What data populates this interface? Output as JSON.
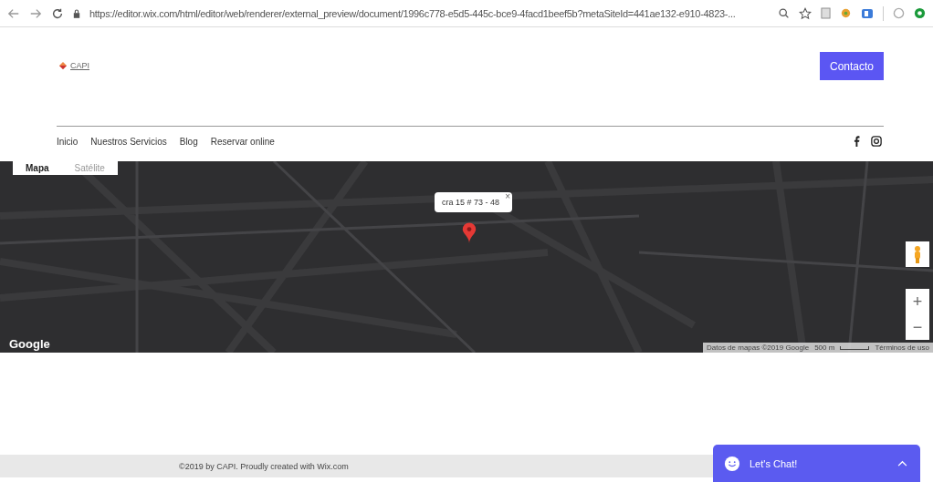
{
  "browser": {
    "url": "https://editor.wix.com/html/editor/web/renderer/external_preview/document/1996c778-e5d5-445c-bce9-4facd1beef5b?metaSiteId=441ae132-e910-4823-..."
  },
  "header": {
    "logo": "CAPI",
    "contact_button": "Contacto"
  },
  "nav": [
    {
      "label": "Inicio"
    },
    {
      "label": "Nuestros Servicios"
    },
    {
      "label": "Blog"
    },
    {
      "label": "Reservar online"
    }
  ],
  "social": [
    {
      "kind": "facebook"
    },
    {
      "kind": "instagram"
    }
  ],
  "map": {
    "map_types": [
      {
        "label": "Mapa",
        "selected": true
      },
      {
        "label": "Satélite",
        "selected": false
      }
    ],
    "info_window": "cra 15 # 73 - 48",
    "close": "×",
    "google": "Google",
    "attribution": "Datos de mapas ©2019 Google",
    "scale": "500 m",
    "terms": "Términos de uso",
    "zoom_in": "+",
    "zoom_out": "−"
  },
  "footer": {
    "text": "©2019 by CAPI. Proudly created with Wix.com"
  },
  "chat": {
    "label": "Let's Chat!",
    "expanded": false
  }
}
